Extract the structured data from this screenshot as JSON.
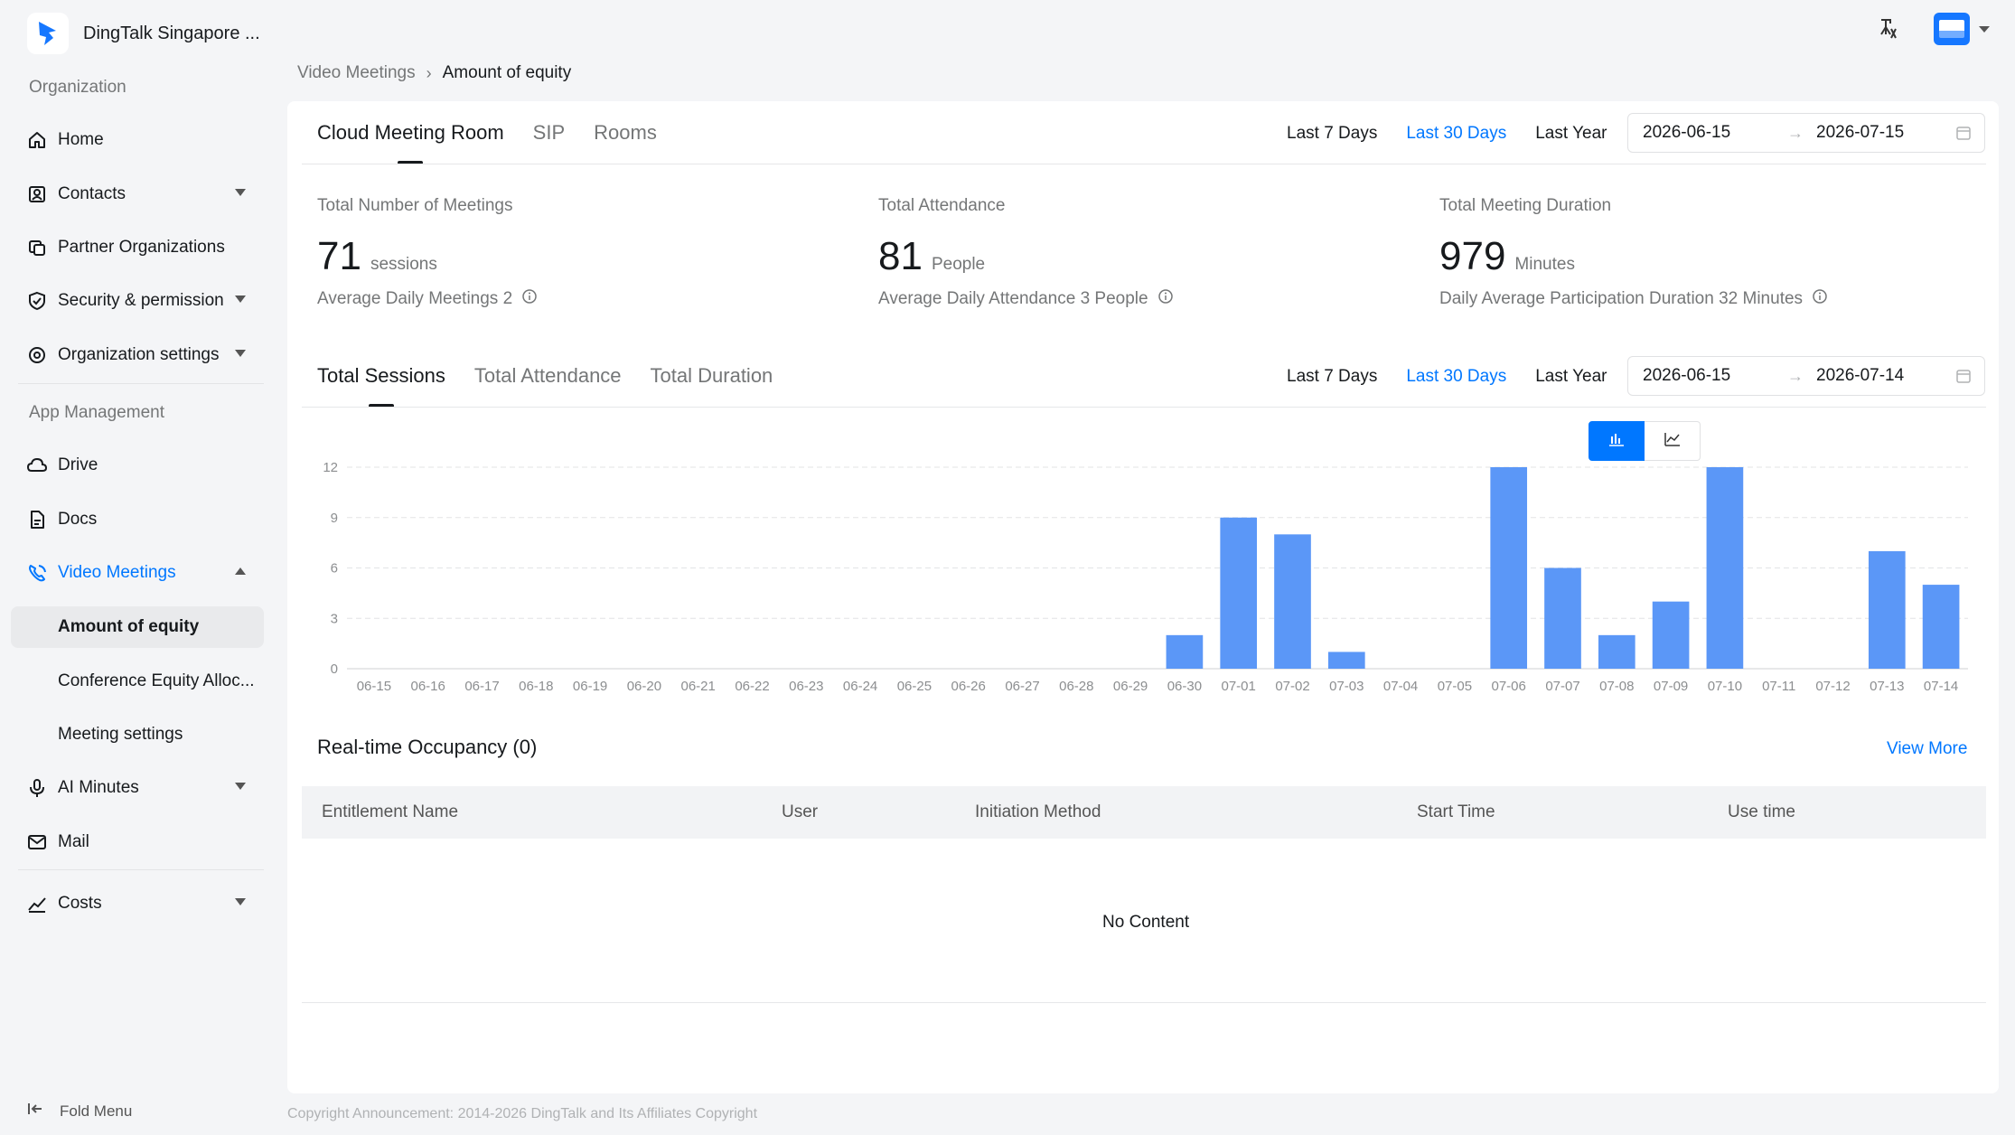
{
  "app": {
    "org_name": "DingTalk Singapore ..."
  },
  "sidebar": {
    "sections": {
      "organization": "Organization",
      "app_management": "App Management"
    },
    "items": [
      {
        "label": "Home"
      },
      {
        "label": "Contacts"
      },
      {
        "label": "Partner Organizations"
      },
      {
        "label": "Security & permission"
      },
      {
        "label": "Organization settings"
      },
      {
        "label": "Drive"
      },
      {
        "label": "Docs"
      },
      {
        "label": "Video Meetings"
      },
      {
        "label": "AI Minutes"
      },
      {
        "label": "Mail"
      },
      {
        "label": "Costs"
      }
    ],
    "sub_items": [
      {
        "label": "Amount of equity"
      },
      {
        "label": "Conference Equity Alloc..."
      },
      {
        "label": "Meeting settings"
      }
    ],
    "fold_label": "Fold Menu"
  },
  "breadcrumb": {
    "parent": "Video Meetings",
    "current": "Amount of equity"
  },
  "top_tabs": [
    "Cloud Meeting Room",
    "SIP",
    "Rooms"
  ],
  "range_options": [
    "Last 7 Days",
    "Last 30 Days",
    "Last Year"
  ],
  "top_range": {
    "selected": "Last 30 Days",
    "start": "2026-06-15",
    "end": "2026-07-15"
  },
  "stats": [
    {
      "label": "Total Number of Meetings",
      "value": "71",
      "unit": "sessions",
      "sub": "Average Daily Meetings 2"
    },
    {
      "label": "Total Attendance",
      "value": "81",
      "unit": "People",
      "sub": "Average Daily Attendance 3 People"
    },
    {
      "label": "Total Meeting Duration",
      "value": "979",
      "unit": "Minutes",
      "sub": "Daily Average Participation Duration 32 Minutes"
    }
  ],
  "chart_tabs": [
    "Total Sessions",
    "Total Attendance",
    "Total Duration"
  ],
  "chart_range": {
    "selected": "Last 30 Days",
    "start": "2026-06-15",
    "end": "2026-07-14"
  },
  "colors": {
    "accent": "#0077ff",
    "bar": "#5b97f7"
  },
  "chart_data": {
    "type": "bar",
    "categories": [
      "06-15",
      "06-16",
      "06-17",
      "06-18",
      "06-19",
      "06-20",
      "06-21",
      "06-22",
      "06-23",
      "06-24",
      "06-25",
      "06-26",
      "06-27",
      "06-28",
      "06-29",
      "06-30",
      "07-01",
      "07-02",
      "07-03",
      "07-04",
      "07-05",
      "07-06",
      "07-07",
      "07-08",
      "07-09",
      "07-10",
      "07-11",
      "07-12",
      "07-13",
      "07-14"
    ],
    "values": [
      0,
      0,
      0,
      0,
      0,
      0,
      0,
      0,
      0,
      0,
      0,
      0,
      0,
      0,
      0,
      2,
      9,
      8,
      1,
      0,
      0,
      12,
      6,
      2,
      4,
      12,
      0,
      0,
      7,
      5
    ],
    "yticks": [
      "0",
      "3",
      "6",
      "9",
      "12"
    ],
    "ylim": [
      0,
      12
    ],
    "grid": true
  },
  "occupancy": {
    "title": "Real-time Occupancy (0)",
    "view_more": "View More",
    "columns": [
      "Entitlement Name",
      "User",
      "Initiation Method",
      "Start Time",
      "Use time"
    ],
    "empty_text": "No Content"
  },
  "footer": {
    "copyright": "Copyright Announcement: 2014-2026 DingTalk and Its Affiliates Copyright"
  }
}
